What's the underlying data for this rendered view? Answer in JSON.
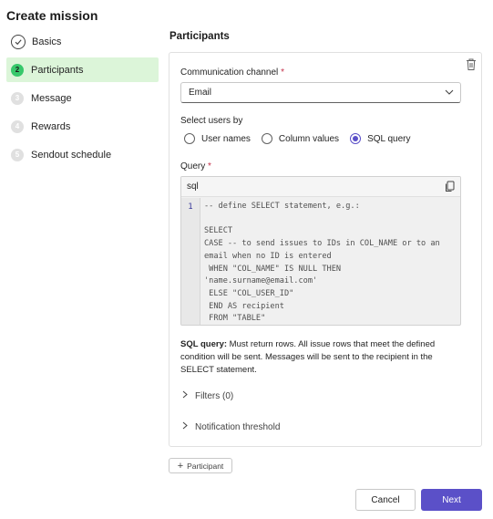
{
  "page": {
    "title": "Create mission"
  },
  "steps": [
    {
      "number": "",
      "label": "Basics",
      "state": "done"
    },
    {
      "number": "2",
      "label": "Participants",
      "state": "active"
    },
    {
      "number": "3",
      "label": "Message",
      "state": "pending"
    },
    {
      "number": "4",
      "label": "Rewards",
      "state": "pending"
    },
    {
      "number": "5",
      "label": "Sendout schedule",
      "state": "pending"
    }
  ],
  "section": {
    "title": "Participants"
  },
  "channel": {
    "label": "Communication channel",
    "required_mark": "*",
    "value": "Email"
  },
  "select_users": {
    "label": "Select users by",
    "options": [
      "User names",
      "Column values",
      "SQL query"
    ],
    "selected": "SQL query"
  },
  "query": {
    "label": "Query",
    "required_mark": "*",
    "language": "sql",
    "line_number": "1",
    "code": "-- define SELECT statement, e.g.:\n\nSELECT\nCASE -- to send issues to IDs in COL_NAME or to an\nemail when no ID is entered\n WHEN \"COL_NAME\" IS NULL THEN\n'name.surname@email.com'\n ELSE \"COL_USER_ID\"\n END AS recipient\n FROM \"TABLE\""
  },
  "hint": {
    "bold": "SQL query:",
    "text": " Must return rows. All issue rows that meet the defined condition will be sent. Messages will be sent to the recipient in the SELECT statement."
  },
  "filters": {
    "label": "Filters (0)"
  },
  "notification": {
    "label": "Notification threshold"
  },
  "add_participant": {
    "label": "Participant"
  },
  "footer": {
    "cancel": "Cancel",
    "next": "Next"
  },
  "colors": {
    "accent": "#5b50c8",
    "active_step_bg": "#dcf5d9",
    "active_step_badge": "#37c86b",
    "required": "#c4314b"
  },
  "icons": {
    "trash": "trash-icon",
    "copy": "copy-icon",
    "chevron": "chevron-down-icon",
    "check": "check-circle-icon"
  }
}
